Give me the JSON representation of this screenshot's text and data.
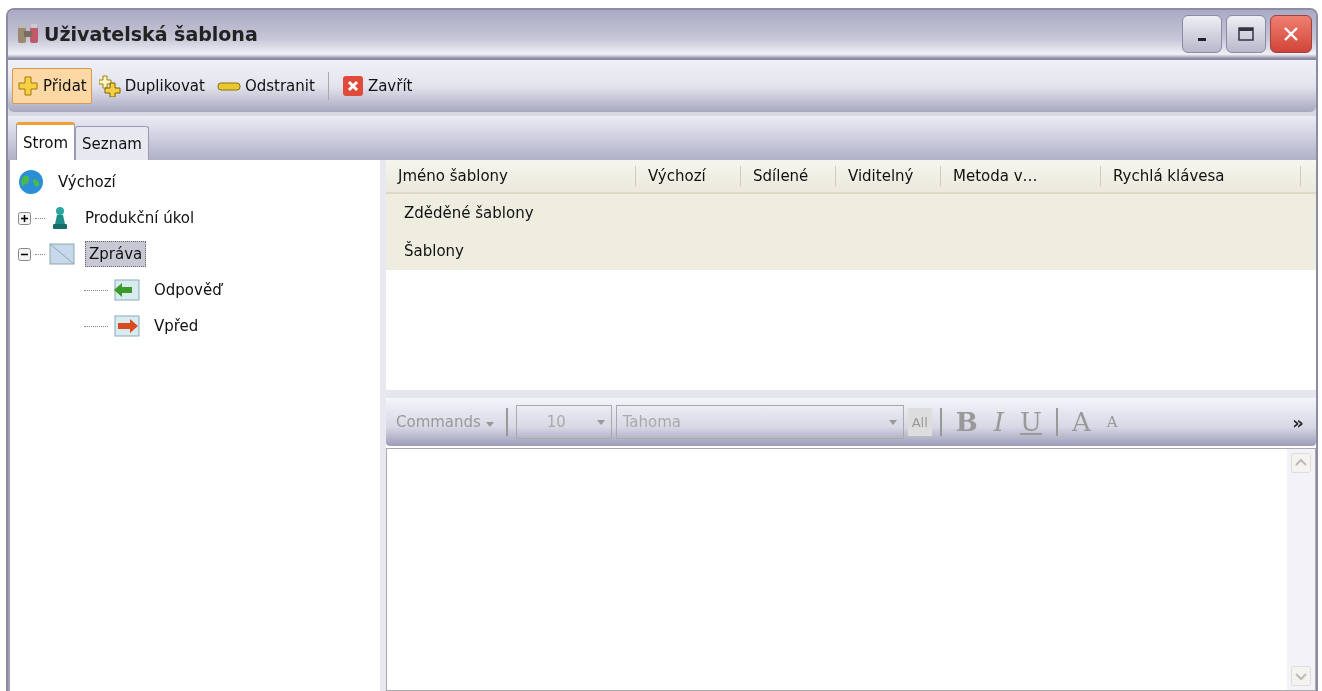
{
  "window": {
    "title": "Uživatelská šablona"
  },
  "toolbar": [
    {
      "label": "Přidat",
      "kind": "add",
      "highlighted": true
    },
    {
      "label": "Duplikovat",
      "kind": "duplicate",
      "highlighted": false
    },
    {
      "label": "Odstranit",
      "kind": "remove",
      "highlighted": false
    },
    {
      "label": "Zavřít",
      "kind": "close",
      "highlighted": false
    }
  ],
  "tabs": [
    {
      "label": "Strom",
      "selected": true
    },
    {
      "label": "Seznam",
      "selected": false
    }
  ],
  "tree": [
    {
      "label": "Výchozí",
      "selected": false
    },
    {
      "label": "Produkční úkol",
      "selected": false,
      "expanded": false
    },
    {
      "label": "Zpráva",
      "selected": true,
      "expanded": true,
      "children": [
        {
          "label": "Odpověď",
          "selected": false
        },
        {
          "label": "Vpřed",
          "selected": false
        }
      ]
    }
  ],
  "table": {
    "columns": [
      "Jméno šablony",
      "Výchozí",
      "Sdílené",
      "Viditelný",
      "Metoda v…",
      "Rychlá klávesa"
    ],
    "rows": [
      {
        "name": "Zděděné šablony"
      },
      {
        "name": "Šablony"
      }
    ]
  },
  "editor_toolbar": {
    "commands": "Commands",
    "font_size": "10",
    "font_name": "Tahoma",
    "all": "All",
    "bold": "B",
    "italic": "I",
    "underline": "U",
    "grow": "A",
    "shrink": "A",
    "more": "»",
    "disabled": true
  }
}
